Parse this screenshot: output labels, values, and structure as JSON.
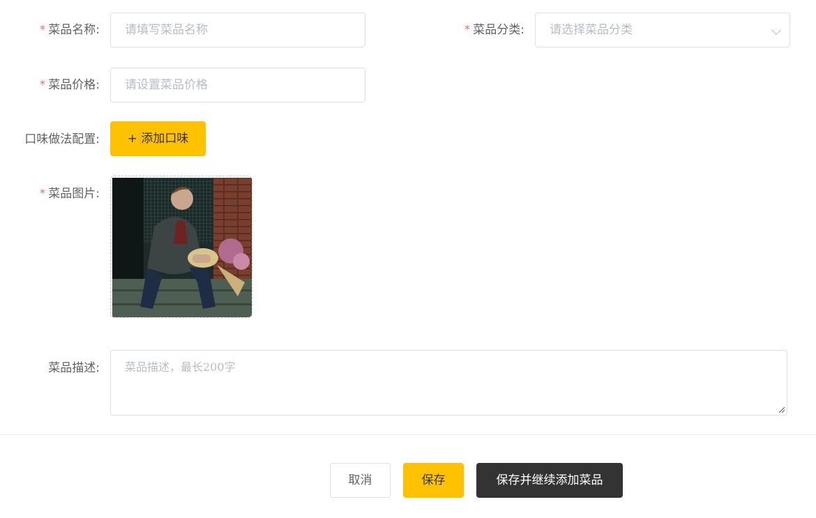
{
  "form": {
    "required_mark": "*",
    "dish_name": {
      "label": "菜品名称:",
      "placeholder": "请填写菜品名称"
    },
    "dish_category": {
      "label": "菜品分类:",
      "placeholder": "请选择菜品分类",
      "icon": "chevron-down-icon"
    },
    "dish_price": {
      "label": "菜品价格:",
      "placeholder": "请设置菜品价格"
    },
    "flavor": {
      "label": "口味做法配置:",
      "add_button": "+ 添加口味"
    },
    "dish_image": {
      "label": "菜品图片:"
    },
    "description": {
      "label": "菜品描述:",
      "placeholder": "菜品描述，最长200字"
    }
  },
  "footer": {
    "cancel_label": "取消",
    "save_label": "保存",
    "save_continue_label": "保存并继续添加菜品"
  },
  "colors": {
    "accent": "#ffc200",
    "dark_button": "#333333",
    "required": "#f56c6c",
    "border": "#dcdfe6",
    "placeholder": "#b8bcc4"
  }
}
